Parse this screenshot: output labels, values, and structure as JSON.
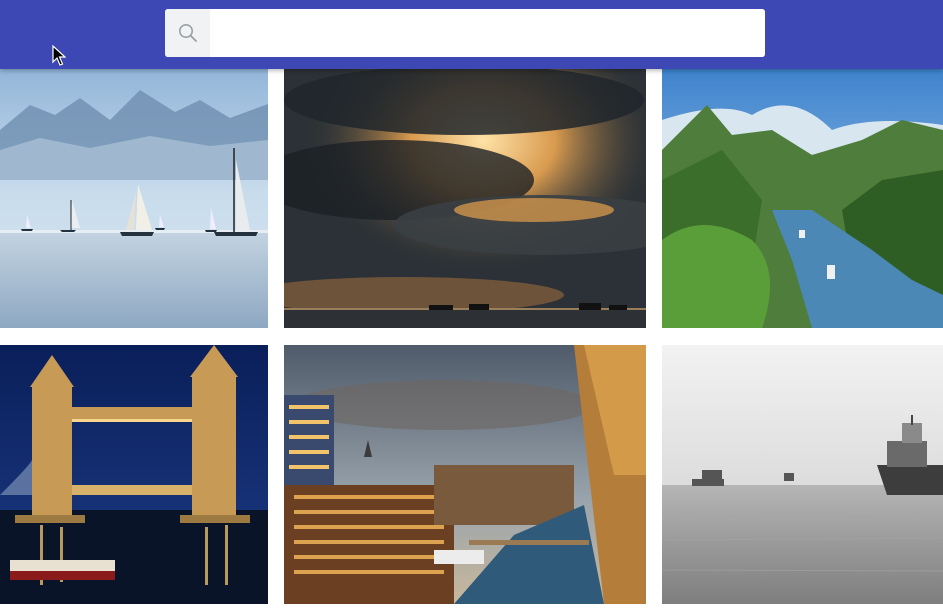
{
  "search": {
    "placeholder": "",
    "value": "",
    "icon": "search-icon"
  },
  "gallery": {
    "images": [
      {
        "subject": "sailboats-on-lake",
        "colors": {
          "sky": "#bcd6ea",
          "water": "#9fb9cf"
        }
      },
      {
        "subject": "dramatic-sunset-clouds-over-sea",
        "colors": {
          "sky": "#2b3136",
          "glow": "#f0a84a"
        }
      },
      {
        "subject": "fjord-with-green-mountains",
        "colors": {
          "sky": "#4b8fd3",
          "hills": "#3c7a2e",
          "water": "#4f8db8"
        }
      },
      {
        "subject": "tower-bridge-at-night",
        "colors": {
          "sky": "#0f2a6a",
          "lights": "#f4c770"
        }
      },
      {
        "subject": "harbor-city-at-dusk",
        "colors": {
          "sky": "#6f7b89",
          "buildings": "#8a5a35"
        }
      },
      {
        "subject": "black-and-white-ships-in-fog",
        "colors": {
          "sky": "#e8e8e8",
          "sea": "#9a9a9a"
        }
      }
    ]
  },
  "colors": {
    "header": "#3d48b5",
    "search_button_bg": "#f1f2f4"
  }
}
